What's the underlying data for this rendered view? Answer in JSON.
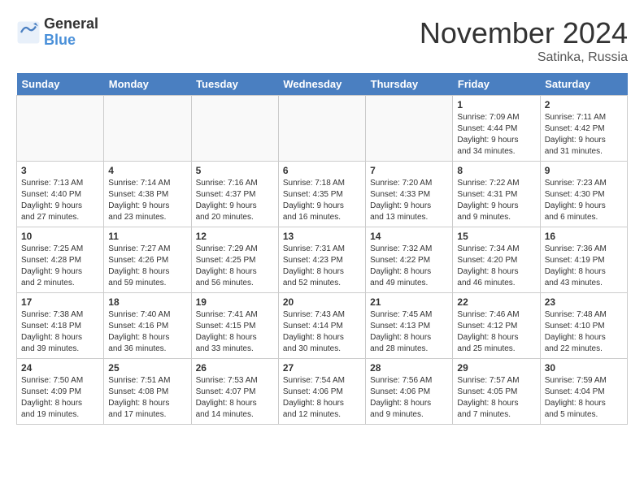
{
  "logo": {
    "general": "General",
    "blue": "Blue"
  },
  "title": "November 2024",
  "subtitle": "Satinka, Russia",
  "days_header": [
    "Sunday",
    "Monday",
    "Tuesday",
    "Wednesday",
    "Thursday",
    "Friday",
    "Saturday"
  ],
  "weeks": [
    [
      {
        "day": "",
        "info": ""
      },
      {
        "day": "",
        "info": ""
      },
      {
        "day": "",
        "info": ""
      },
      {
        "day": "",
        "info": ""
      },
      {
        "day": "",
        "info": ""
      },
      {
        "day": "1",
        "info": "Sunrise: 7:09 AM\nSunset: 4:44 PM\nDaylight: 9 hours\nand 34 minutes."
      },
      {
        "day": "2",
        "info": "Sunrise: 7:11 AM\nSunset: 4:42 PM\nDaylight: 9 hours\nand 31 minutes."
      }
    ],
    [
      {
        "day": "3",
        "info": "Sunrise: 7:13 AM\nSunset: 4:40 PM\nDaylight: 9 hours\nand 27 minutes."
      },
      {
        "day": "4",
        "info": "Sunrise: 7:14 AM\nSunset: 4:38 PM\nDaylight: 9 hours\nand 23 minutes."
      },
      {
        "day": "5",
        "info": "Sunrise: 7:16 AM\nSunset: 4:37 PM\nDaylight: 9 hours\nand 20 minutes."
      },
      {
        "day": "6",
        "info": "Sunrise: 7:18 AM\nSunset: 4:35 PM\nDaylight: 9 hours\nand 16 minutes."
      },
      {
        "day": "7",
        "info": "Sunrise: 7:20 AM\nSunset: 4:33 PM\nDaylight: 9 hours\nand 13 minutes."
      },
      {
        "day": "8",
        "info": "Sunrise: 7:22 AM\nSunset: 4:31 PM\nDaylight: 9 hours\nand 9 minutes."
      },
      {
        "day": "9",
        "info": "Sunrise: 7:23 AM\nSunset: 4:30 PM\nDaylight: 9 hours\nand 6 minutes."
      }
    ],
    [
      {
        "day": "10",
        "info": "Sunrise: 7:25 AM\nSunset: 4:28 PM\nDaylight: 9 hours\nand 2 minutes."
      },
      {
        "day": "11",
        "info": "Sunrise: 7:27 AM\nSunset: 4:26 PM\nDaylight: 8 hours\nand 59 minutes."
      },
      {
        "day": "12",
        "info": "Sunrise: 7:29 AM\nSunset: 4:25 PM\nDaylight: 8 hours\nand 56 minutes."
      },
      {
        "day": "13",
        "info": "Sunrise: 7:31 AM\nSunset: 4:23 PM\nDaylight: 8 hours\nand 52 minutes."
      },
      {
        "day": "14",
        "info": "Sunrise: 7:32 AM\nSunset: 4:22 PM\nDaylight: 8 hours\nand 49 minutes."
      },
      {
        "day": "15",
        "info": "Sunrise: 7:34 AM\nSunset: 4:20 PM\nDaylight: 8 hours\nand 46 minutes."
      },
      {
        "day": "16",
        "info": "Sunrise: 7:36 AM\nSunset: 4:19 PM\nDaylight: 8 hours\nand 43 minutes."
      }
    ],
    [
      {
        "day": "17",
        "info": "Sunrise: 7:38 AM\nSunset: 4:18 PM\nDaylight: 8 hours\nand 39 minutes."
      },
      {
        "day": "18",
        "info": "Sunrise: 7:40 AM\nSunset: 4:16 PM\nDaylight: 8 hours\nand 36 minutes."
      },
      {
        "day": "19",
        "info": "Sunrise: 7:41 AM\nSunset: 4:15 PM\nDaylight: 8 hours\nand 33 minutes."
      },
      {
        "day": "20",
        "info": "Sunrise: 7:43 AM\nSunset: 4:14 PM\nDaylight: 8 hours\nand 30 minutes."
      },
      {
        "day": "21",
        "info": "Sunrise: 7:45 AM\nSunset: 4:13 PM\nDaylight: 8 hours\nand 28 minutes."
      },
      {
        "day": "22",
        "info": "Sunrise: 7:46 AM\nSunset: 4:12 PM\nDaylight: 8 hours\nand 25 minutes."
      },
      {
        "day": "23",
        "info": "Sunrise: 7:48 AM\nSunset: 4:10 PM\nDaylight: 8 hours\nand 22 minutes."
      }
    ],
    [
      {
        "day": "24",
        "info": "Sunrise: 7:50 AM\nSunset: 4:09 PM\nDaylight: 8 hours\nand 19 minutes."
      },
      {
        "day": "25",
        "info": "Sunrise: 7:51 AM\nSunset: 4:08 PM\nDaylight: 8 hours\nand 17 minutes."
      },
      {
        "day": "26",
        "info": "Sunrise: 7:53 AM\nSunset: 4:07 PM\nDaylight: 8 hours\nand 14 minutes."
      },
      {
        "day": "27",
        "info": "Sunrise: 7:54 AM\nSunset: 4:06 PM\nDaylight: 8 hours\nand 12 minutes."
      },
      {
        "day": "28",
        "info": "Sunrise: 7:56 AM\nSunset: 4:06 PM\nDaylight: 8 hours\nand 9 minutes."
      },
      {
        "day": "29",
        "info": "Sunrise: 7:57 AM\nSunset: 4:05 PM\nDaylight: 8 hours\nand 7 minutes."
      },
      {
        "day": "30",
        "info": "Sunrise: 7:59 AM\nSunset: 4:04 PM\nDaylight: 8 hours\nand 5 minutes."
      }
    ]
  ]
}
